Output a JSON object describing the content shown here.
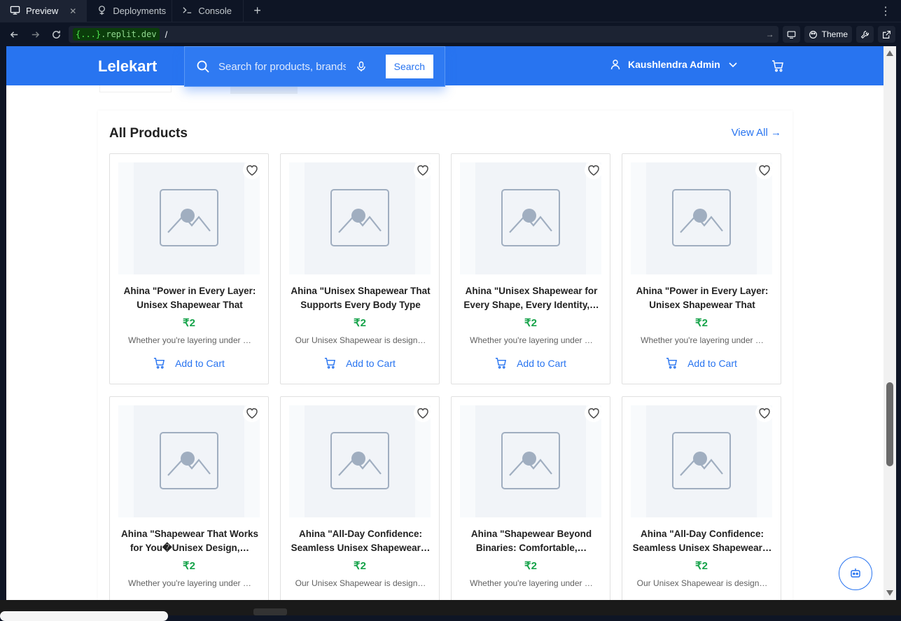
{
  "tabs": [
    {
      "label": "Preview",
      "icon": "monitor-icon",
      "active": true
    },
    {
      "label": "Deployments",
      "icon": "deploy-icon",
      "active": false
    },
    {
      "label": "Console",
      "icon": "terminal-icon",
      "active": false
    }
  ],
  "address": {
    "host_prefix": "{...}",
    "host_rest": ".replit.dev",
    "path": "/",
    "theme_label": "Theme"
  },
  "site": {
    "logo": "Lelekart",
    "search_placeholder": "Search for products, brands and more",
    "search_button": "Search",
    "user_name": "Kaushlendra Admin"
  },
  "section": {
    "title": "All Products",
    "view_all": "View All →"
  },
  "products": [
    {
      "name": "Ahina \"Power in Every Layer: Unisex Shapewear That Lifts,…",
      "price": "₹2",
      "desc": "Whether you're layering under …",
      "cart": "Add to Cart"
    },
    {
      "name": "Ahina \"Unisex Shapewear That Supports Every Body Type an…",
      "price": "₹2",
      "desc": "Our Unisex Shapewear is design…",
      "cart": "Add to Cart"
    },
    {
      "name": "Ahina \"Unisex Shapewear for Every Shape, Every Identity,…",
      "price": "₹2",
      "desc": "Whether you're layering under …",
      "cart": "Add to Cart"
    },
    {
      "name": "Ahina \"Power in Every Layer: Unisex Shapewear That Lifts,…",
      "price": "₹2",
      "desc": "Whether you're layering under …",
      "cart": "Add to Cart"
    },
    {
      "name": "Ahina \"Shapewear That Works for You�Unisex Design,…",
      "price": "₹2",
      "desc": "Whether you're layering under …",
      "cart": "Add to Cart"
    },
    {
      "name": "Ahina \"All-Day Confidence: Seamless Unisex Shapewear…",
      "price": "₹2",
      "desc": "Our Unisex Shapewear is design…",
      "cart": "Add to Cart"
    },
    {
      "name": "Ahina \"Shapewear Beyond Binaries: Comfortable,…",
      "price": "₹2",
      "desc": "Whether you're layering under …",
      "cart": "Add to Cart"
    },
    {
      "name": "Ahina \"All-Day Confidence: Seamless Unisex Shapewear…",
      "price": "₹2",
      "desc": "Our Unisex Shapewear is design…",
      "cart": "Add to Cart"
    }
  ],
  "colors": {
    "brand": "#2874f0",
    "price": "#16a34a",
    "ide_bg": "#0e1525"
  }
}
